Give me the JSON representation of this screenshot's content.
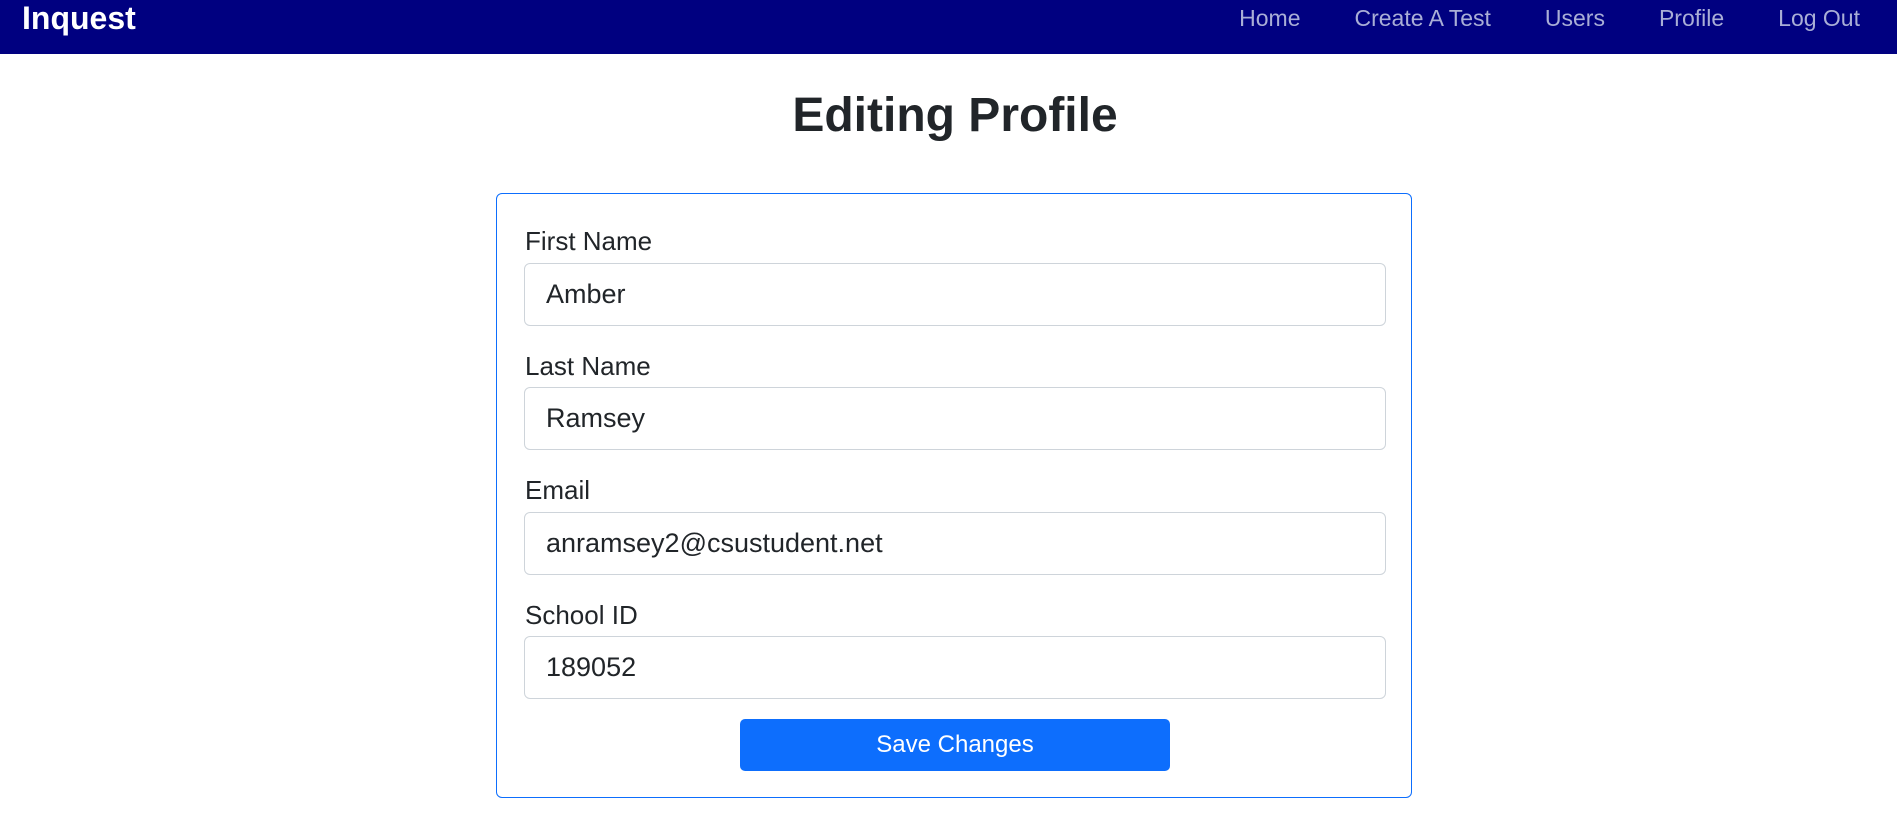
{
  "nav": {
    "brand": "Inquest",
    "links": [
      "Home",
      "Create A Test",
      "Users",
      "Profile",
      "Log Out"
    ]
  },
  "page": {
    "title": "Editing Profile"
  },
  "form": {
    "fields": [
      {
        "label": "First Name",
        "value": "Amber"
      },
      {
        "label": "Last Name",
        "value": "Ramsey"
      },
      {
        "label": "Email",
        "value": "anramsey2@csustudent.net"
      },
      {
        "label": "School ID",
        "value": "189052"
      }
    ],
    "submit_label": "Save Changes"
  },
  "colors": {
    "navbar": "#000080",
    "primary": "#0d6efd"
  }
}
